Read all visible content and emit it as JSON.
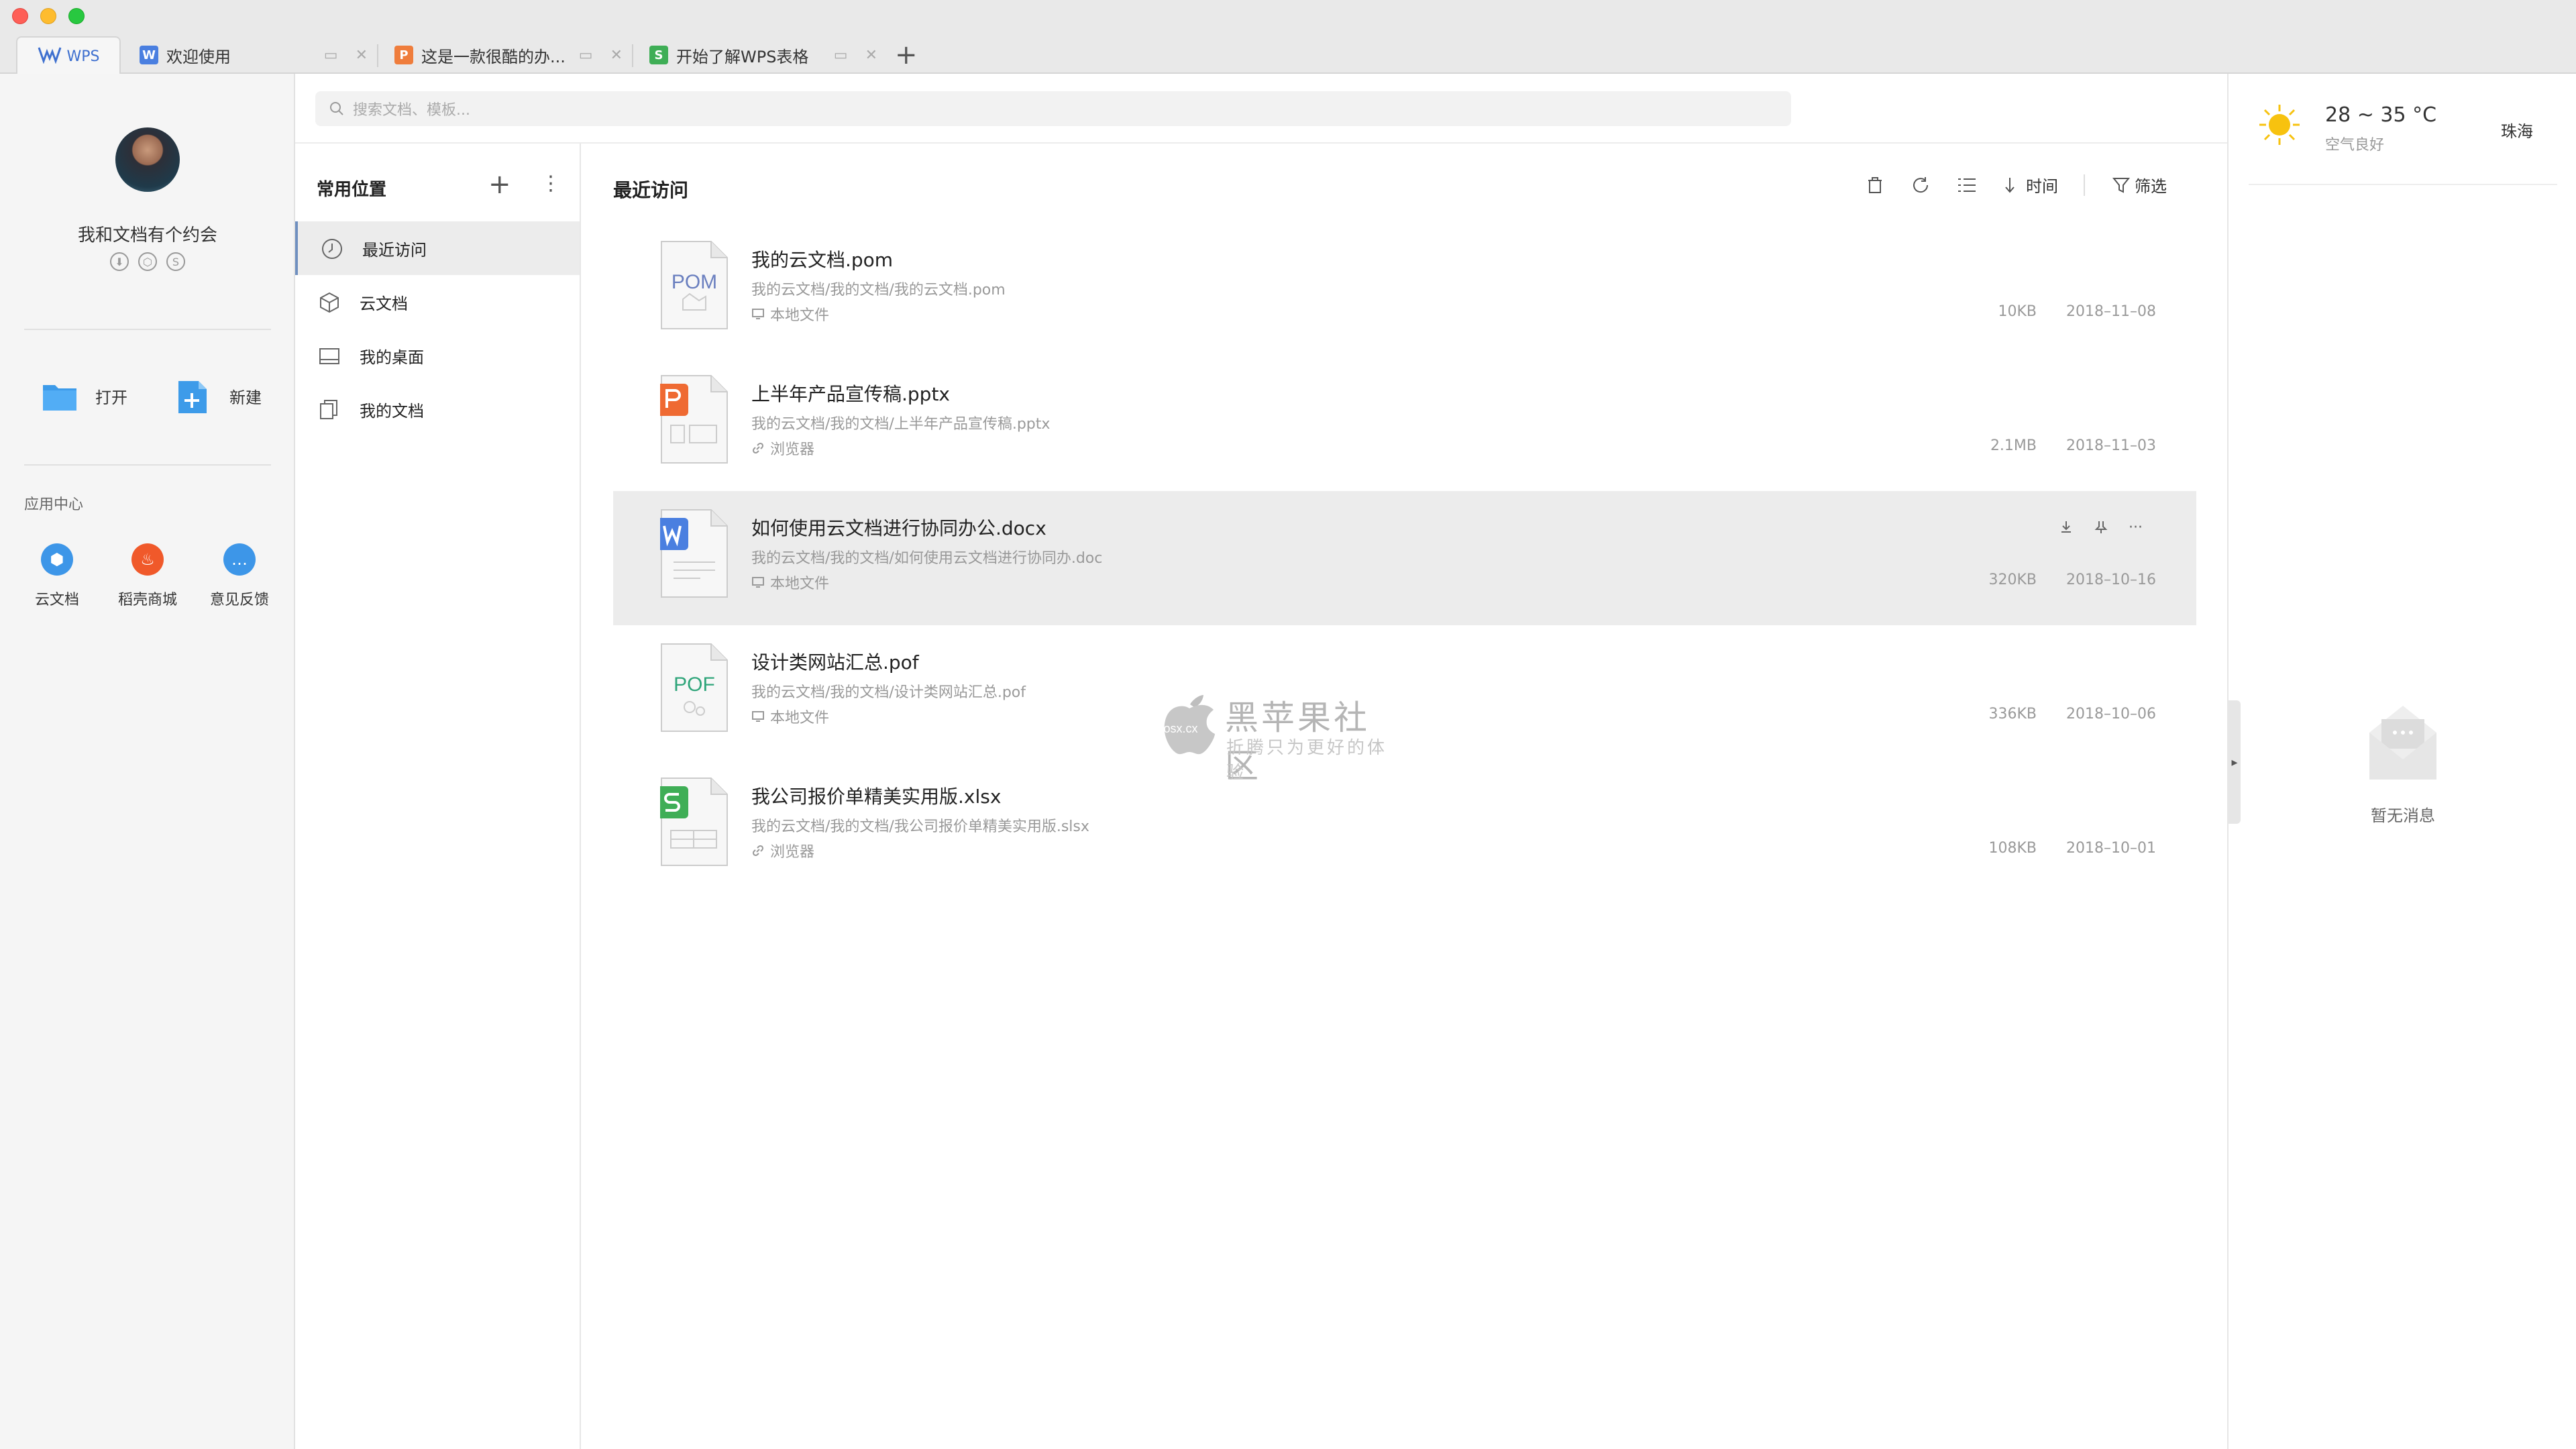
{
  "tabs": {
    "home_label": "WPS",
    "items": [
      {
        "icon": "W",
        "color": "#4a7fe0",
        "label": "欢迎使用"
      },
      {
        "icon": "P",
        "color": "#ef7d3c",
        "label": "这是一款很酷的办..."
      },
      {
        "icon": "S",
        "color": "#3fae56",
        "label": "开始了解WPS表格"
      }
    ],
    "add_label": "+"
  },
  "user": {
    "name": "我和文档有个约会"
  },
  "quick_actions": {
    "open_label": "打开",
    "new_label": "新建"
  },
  "app_center": {
    "title": "应用中心",
    "apps": [
      {
        "label": "云文档",
        "color": "#3d96e8"
      },
      {
        "label": "稻壳商城",
        "color": "#f0592a"
      },
      {
        "label": "意见反馈",
        "color": "#3d96e8"
      }
    ]
  },
  "search": {
    "placeholder": "搜索文档、模板..."
  },
  "locations": {
    "title": "常用位置",
    "items": [
      {
        "label": "最近访问",
        "icon": "clock-icon",
        "active": true
      },
      {
        "label": "云文档",
        "icon": "cube-icon",
        "active": false
      },
      {
        "label": "我的桌面",
        "icon": "desktop-icon",
        "active": false
      },
      {
        "label": "我的文档",
        "icon": "documents-icon",
        "active": false
      }
    ]
  },
  "main": {
    "title": "最近访问",
    "toolbar": {
      "sort_label": "时间",
      "filter_label": "筛选"
    },
    "files": [
      {
        "name": "我的云文档.pom",
        "path": "我的云文档/我的文档/我的云文档.pom",
        "source": "本地文件",
        "source_icon": "monitor-icon",
        "size": "10KB",
        "date": "2018–11–08",
        "type": "POM",
        "color": "#6a7fbf"
      },
      {
        "name": "上半年产品宣传稿.pptx",
        "path": "我的云文档/我的文档/上半年产品宣传稿.pptx",
        "source": "浏览器",
        "source_icon": "link-icon",
        "size": "2.1MB",
        "date": "2018–11–03",
        "type": "P",
        "color": "#ef6a32"
      },
      {
        "name": "如何使用云文档进行协同办公.docx",
        "path": "我的云文档/我的文档/如何使用云文档进行协同办.doc",
        "source": "本地文件",
        "source_icon": "monitor-icon",
        "size": "320KB",
        "date": "2018–10–16",
        "type": "W",
        "color": "#4a7fe0",
        "hover": true
      },
      {
        "name": "设计类网站汇总.pof",
        "path": "我的云文档/我的文档/设计类网站汇总.pof",
        "source": "本地文件",
        "source_icon": "monitor-icon",
        "size": "336KB",
        "date": "2018–10–06",
        "type": "POF",
        "color": "#2fa57a"
      },
      {
        "name": "我公司报价单精美实用版.xlsx",
        "path": "我的云文档/我的文档/我公司报价单精美实用版.slsx",
        "source": "浏览器",
        "source_icon": "link-icon",
        "size": "108KB",
        "date": "2018–10–01",
        "type": "S",
        "color": "#3fae56"
      }
    ]
  },
  "watermark": {
    "title": "黑苹果社区",
    "subtitle": "折腾只为更好的体验",
    "logo_text": "osx.cx"
  },
  "weather": {
    "temp": "28 ~ 35 °C",
    "desc": "空气良好",
    "city": "珠海"
  },
  "messages": {
    "empty_text": "暂无消息"
  }
}
